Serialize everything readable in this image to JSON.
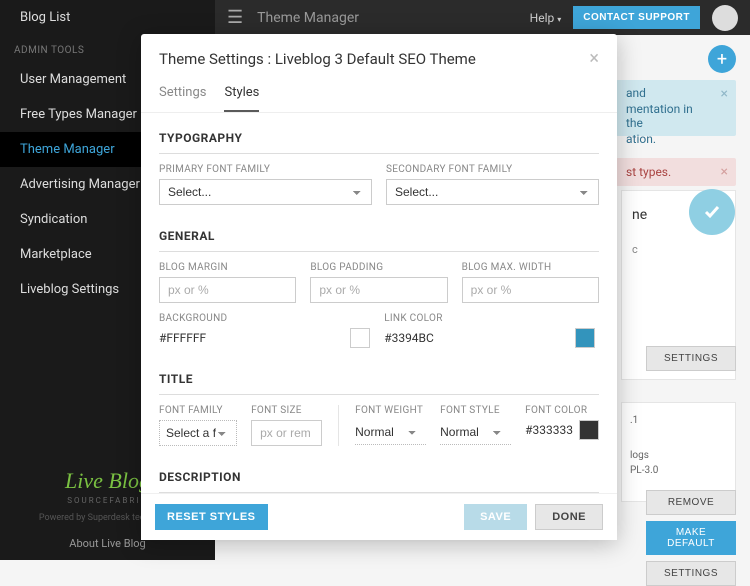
{
  "sidebar": {
    "items": [
      {
        "label": "Blog List"
      }
    ],
    "admin_heading": "ADMIN TOOLS",
    "admin_items": [
      {
        "label": "User Management"
      },
      {
        "label": "Free Types Manager"
      },
      {
        "label": "Theme Manager"
      },
      {
        "label": "Advertising Manager"
      },
      {
        "label": "Syndication"
      },
      {
        "label": "Marketplace"
      },
      {
        "label": "Liveblog Settings"
      }
    ],
    "logo": "Live Blog",
    "logo_sub": "SOURCEFABRIC",
    "powered": "Powered by Superdesk technology",
    "about": "About Live Blog"
  },
  "topbar": {
    "title": "Theme Manager",
    "help": "Help",
    "contact": "CONTACT SUPPORT"
  },
  "alerts": {
    "info1": "and",
    "info2": "mentation in the",
    "info3": "ation.",
    "danger": "st types."
  },
  "card": {
    "title": "ne",
    "sub": "c",
    "settings": "SETTINGS",
    "remove": "REMOVE",
    "make_default": "MAKE DEFAULT",
    "settings2": "SETTINGS"
  },
  "card2": {
    "version": ".1",
    "blogs_label": "logs",
    "license": "PL-3.0"
  },
  "modal": {
    "title": "Theme Settings : Liveblog 3 Default SEO Theme",
    "tabs": {
      "settings": "Settings",
      "styles": "Styles"
    },
    "sections": {
      "typography": "TYPOGRAPHY",
      "general": "GENERAL",
      "title": "TITLE",
      "description": "DESCRIPTION"
    },
    "fields": {
      "primary_font": "PRIMARY FONT FAMILY",
      "secondary_font": "SECONDARY FONT FAMILY",
      "select_ph": "Select...",
      "blog_margin": "BLOG MARGIN",
      "blog_padding": "BLOG PADDING",
      "blog_max_width": "BLOG MAX. WIDTH",
      "px_pct": "px or %",
      "background": "BACKGROUND",
      "bg_value": "#FFFFFF",
      "link_color": "LINK COLOR",
      "link_value": "#3394BC",
      "font_family": "FONT FAMILY",
      "select_font_ph": "Select a font",
      "font_size": "FONT SIZE",
      "px_rem": "px or rem",
      "font_weight": "FONT WEIGHT",
      "normal": "Normal",
      "font_style": "FONT STYLE",
      "font_color": "FONT COLOR",
      "color333": "#333333"
    },
    "footer": {
      "reset": "RESET STYLES",
      "save": "SAVE",
      "done": "DONE"
    }
  },
  "colors": {
    "bg_swatch": "#FFFFFF",
    "link_swatch": "#3394BC",
    "dark_swatch": "#333333"
  }
}
